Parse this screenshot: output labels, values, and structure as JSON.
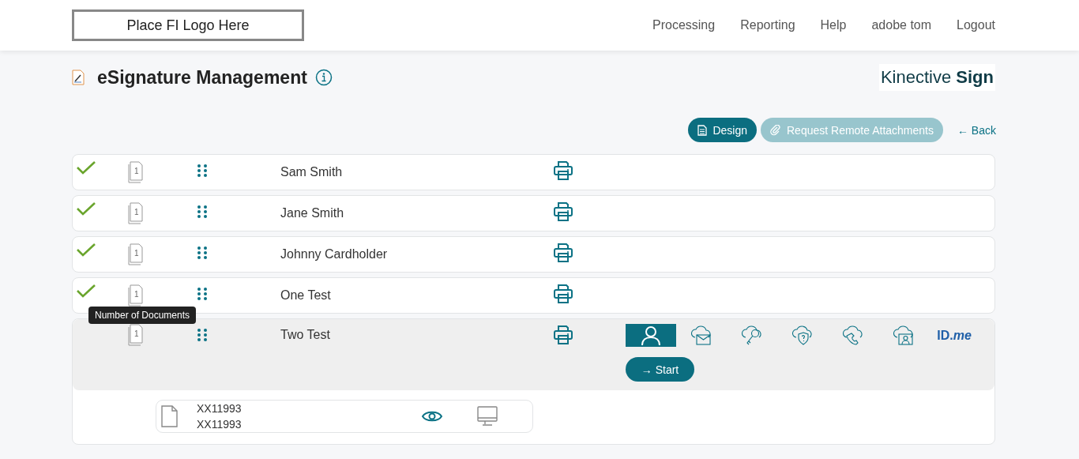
{
  "header": {
    "logo": "Place FI Logo Here",
    "nav": [
      "Processing",
      "Reporting",
      "Help",
      "adobe tom",
      "Logout"
    ]
  },
  "page": {
    "title": "eSignature Management",
    "brand": {
      "light": "Kinective",
      "bold": "Sign"
    }
  },
  "actions": {
    "buttons": [
      {
        "label": "Design",
        "disabled": false
      },
      {
        "label": "Request Remote Attachments",
        "disabled": true
      }
    ],
    "back": "← Back"
  },
  "signers": [
    {
      "name": "Sam Smith",
      "done": true,
      "expanded": false,
      "doc_count": "1"
    },
    {
      "name": "Jane Smith",
      "done": true,
      "expanded": false,
      "doc_count": "1"
    },
    {
      "name": "Johnny Cardholder",
      "done": true,
      "expanded": false,
      "doc_count": "1"
    },
    {
      "name": "One Test",
      "done": true,
      "expanded": false,
      "doc_count": "1"
    },
    {
      "name": "Two Test",
      "done": false,
      "expanded": true,
      "doc_count": "1",
      "tooltip": "Number of Documents",
      "auth_methods": [
        {
          "kind": "person",
          "selected": true
        },
        {
          "kind": "cloud-mail",
          "selected": false
        },
        {
          "kind": "cloud-key",
          "selected": false
        },
        {
          "kind": "cloud-shield",
          "selected": false
        },
        {
          "kind": "cloud-phone",
          "selected": false
        },
        {
          "kind": "cloud-id",
          "selected": false
        },
        {
          "kind": "idme",
          "label": "ID.*me*",
          "selected": false
        }
      ],
      "start": "→ Start",
      "documents": [
        {
          "lines": [
            "XX11993",
            "XX11993"
          ]
        }
      ]
    }
  ]
}
